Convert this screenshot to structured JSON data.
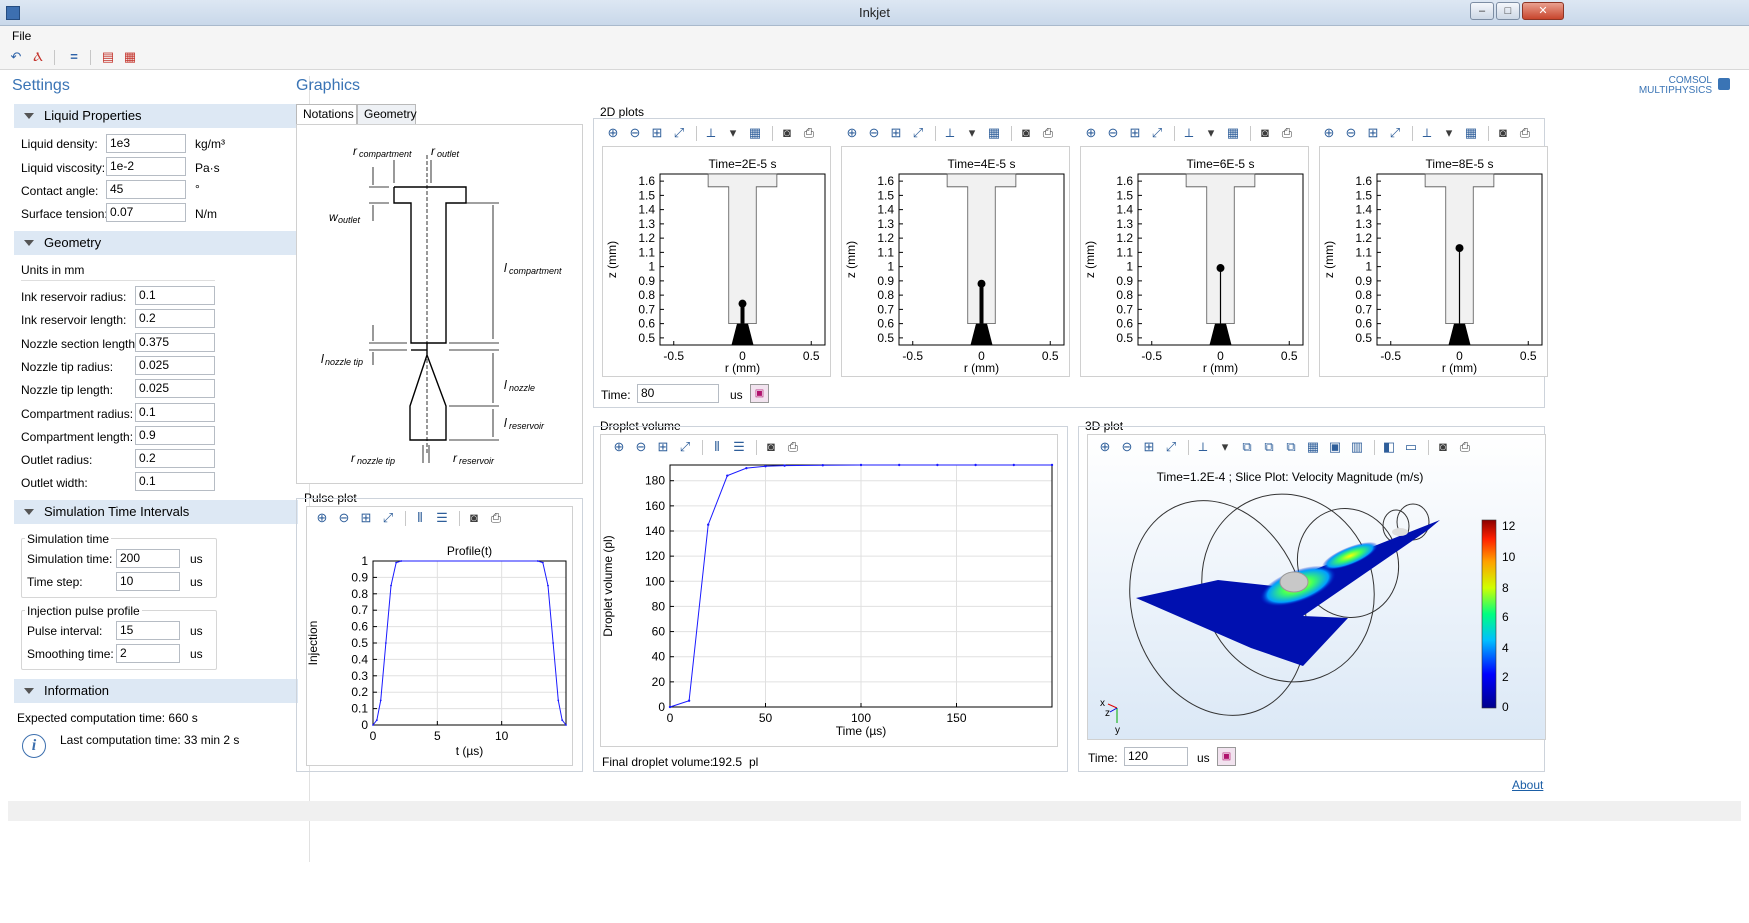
{
  "window": {
    "title": "Inkjet"
  },
  "menu": {
    "file": "File"
  },
  "settings": {
    "title": "Settings",
    "liquid": {
      "header": "Liquid Properties",
      "rows": [
        {
          "label": "Liquid density:",
          "value": "1e3",
          "unit": "kg/m³"
        },
        {
          "label": "Liquid viscosity:",
          "value": "1e-2",
          "unit": "Pa·s"
        },
        {
          "label": "Contact angle:",
          "value": "45",
          "unit": "°"
        },
        {
          "label": "Surface tension:",
          "value": "0.07",
          "unit": "N/m"
        }
      ]
    },
    "geometry": {
      "header": "Geometry",
      "units": "Units in mm",
      "rows": [
        {
          "label": "Ink reservoir radius:",
          "value": "0.1"
        },
        {
          "label": "Ink reservoir length:",
          "value": "0.2"
        },
        {
          "label": "Nozzle section length:",
          "value": "0.375"
        },
        {
          "label": "Nozzle tip radius:",
          "value": "0.025"
        },
        {
          "label": "Nozzle tip length:",
          "value": "0.025"
        },
        {
          "label": "Compartment radius:",
          "value": "0.1"
        },
        {
          "label": "Compartment length:",
          "value": "0.9"
        },
        {
          "label": "Outlet radius:",
          "value": "0.2"
        },
        {
          "label": "Outlet width:",
          "value": "0.1"
        }
      ]
    },
    "simulation": {
      "header": "Simulation Time Intervals",
      "sim_group": "Simulation time",
      "sim_rows": [
        {
          "label": "Simulation time:",
          "value": "200",
          "unit": "us"
        },
        {
          "label": "Time step:",
          "value": "10",
          "unit": "us"
        }
      ],
      "pulse_group": "Injection pulse profile",
      "pulse_rows": [
        {
          "label": "Pulse interval:",
          "value": "15",
          "unit": "us"
        },
        {
          "label": "Smoothing time:",
          "value": "2",
          "unit": "us"
        }
      ]
    },
    "information": {
      "header": "Information",
      "expected": "Expected computation time: 660 s",
      "last": "Last computation time: 33 min 2 s"
    }
  },
  "graphics": {
    "title": "Graphics",
    "brand_top": "COMSOL",
    "brand_bottom": "MULTIPHYSICS",
    "tabs": [
      "Notations",
      "Geometry"
    ],
    "diagram_labels": {
      "r_compartment": "r",
      "r_compartment_sub": "compartment",
      "r_outlet": "r",
      "r_outlet_sub": "outlet",
      "w_outlet": "w",
      "w_outlet_sub": "outlet",
      "l_compartment": "l",
      "l_compartment_sub": "compartment",
      "l_nozzle_tip": "l",
      "l_nozzle_tip_sub": "nozzle tip",
      "l_nozzle": "l",
      "l_nozzle_sub": "nozzle",
      "l_reservoir": "l",
      "l_reservoir_sub": "reservoir",
      "r_nozzle_tip": "r",
      "r_nozzle_tip_sub": "nozzle tip",
      "r_reservoir": "r",
      "r_reservoir_sub": "reservoir"
    },
    "plots2d": {
      "title": "2D plots",
      "time_label": "Time:",
      "time_value": "80",
      "time_unit": "us"
    },
    "pulse": {
      "title": "Pulse plot"
    },
    "droplet": {
      "title": "Droplet volume",
      "final_label": "Final droplet volume:",
      "final_value": "192.5",
      "final_unit": "pl"
    },
    "plot3d": {
      "title": "3D plot",
      "plot_title": "Time=1.2E-4 ; Slice Plot: Velocity Magnitude (m/s)",
      "colorbar_ticks": [
        "12",
        "10",
        "8",
        "6",
        "4",
        "2",
        "0"
      ],
      "time_label": "Time:",
      "time_value": "120",
      "time_unit": "us",
      "axes": [
        "x",
        "z",
        "y"
      ]
    },
    "about": "About"
  },
  "chart_data": [
    {
      "type": "line",
      "title": "Time=2E-5 s",
      "xlabel": "r (mm)",
      "ylabel": "z (mm)",
      "xticks": [
        "-0.5",
        "0",
        "0.5"
      ],
      "yticks": [
        "0.5",
        "0.6",
        "0.7",
        "0.8",
        "0.9",
        "1",
        "1.1",
        "1.2",
        "1.3",
        "1.4",
        "1.5",
        "1.6"
      ],
      "xlim": [
        -0.6,
        0.6
      ],
      "ylim": [
        0.45,
        1.65
      ],
      "droplet_top_z": 0.74
    },
    {
      "type": "line",
      "title": "Time=4E-5 s",
      "xlabel": "r (mm)",
      "ylabel": "z (mm)",
      "xticks": [
        "-0.5",
        "0",
        "0.5"
      ],
      "yticks": [
        "0.5",
        "0.6",
        "0.7",
        "0.8",
        "0.9",
        "1",
        "1.1",
        "1.2",
        "1.3",
        "1.4",
        "1.5",
        "1.6"
      ],
      "xlim": [
        -0.6,
        0.6
      ],
      "ylim": [
        0.45,
        1.65
      ],
      "droplet_top_z": 0.88
    },
    {
      "type": "line",
      "title": "Time=6E-5 s",
      "xlabel": "r (mm)",
      "ylabel": "z (mm)",
      "xticks": [
        "-0.5",
        "0",
        "0.5"
      ],
      "yticks": [
        "0.5",
        "0.6",
        "0.7",
        "0.8",
        "0.9",
        "1",
        "1.1",
        "1.2",
        "1.3",
        "1.4",
        "1.5",
        "1.6"
      ],
      "xlim": [
        -0.6,
        0.6
      ],
      "ylim": [
        0.45,
        1.65
      ],
      "droplet_top_z": 0.99
    },
    {
      "type": "line",
      "title": "Time=8E-5 s",
      "xlabel": "r (mm)",
      "ylabel": "z (mm)",
      "xticks": [
        "-0.5",
        "0",
        "0.5"
      ],
      "yticks": [
        "0.5",
        "0.6",
        "0.7",
        "0.8",
        "0.9",
        "1",
        "1.1",
        "1.2",
        "1.3",
        "1.4",
        "1.5",
        "1.6"
      ],
      "xlim": [
        -0.6,
        0.6
      ],
      "ylim": [
        0.45,
        1.65
      ],
      "droplet_top_z": 1.13
    },
    {
      "type": "line",
      "title": "Profile(t)",
      "xlabel": "t (µs)",
      "ylabel": "Injection",
      "xticks": [
        "0",
        "5",
        "10"
      ],
      "yticks": [
        "0",
        "0.1",
        "0.2",
        "0.3",
        "0.4",
        "0.5",
        "0.6",
        "0.7",
        "0.8",
        "0.9",
        "1"
      ],
      "xlim": [
        0,
        15
      ],
      "ylim": [
        0,
        1
      ],
      "series": [
        {
          "x": [
            0,
            0.3,
            0.6,
            1,
            1.4,
            1.8,
            2.2,
            12.8,
            13.2,
            13.6,
            14,
            14.4,
            14.7,
            15
          ],
          "y": [
            0,
            0.03,
            0.15,
            0.5,
            0.85,
            0.99,
            1,
            1,
            0.99,
            0.85,
            0.5,
            0.15,
            0.03,
            0
          ]
        }
      ]
    },
    {
      "type": "line",
      "title": "",
      "xlabel": "Time (µs)",
      "ylabel": "Droplet volume (pl)",
      "xticks": [
        "0",
        "50",
        "100",
        "150"
      ],
      "yticks": [
        "0",
        "20",
        "40",
        "60",
        "80",
        "100",
        "120",
        "140",
        "160",
        "180"
      ],
      "xlim": [
        0,
        200
      ],
      "ylim": [
        0,
        192.5
      ],
      "series": [
        {
          "x": [
            0,
            10,
            20,
            30,
            40,
            50,
            60,
            80,
            100,
            120,
            140,
            160,
            180,
            200
          ],
          "y": [
            0,
            5,
            145,
            184,
            190,
            191.5,
            192,
            192.3,
            192.5,
            192.5,
            192.5,
            192.5,
            192.5,
            192.5
          ]
        }
      ]
    }
  ]
}
